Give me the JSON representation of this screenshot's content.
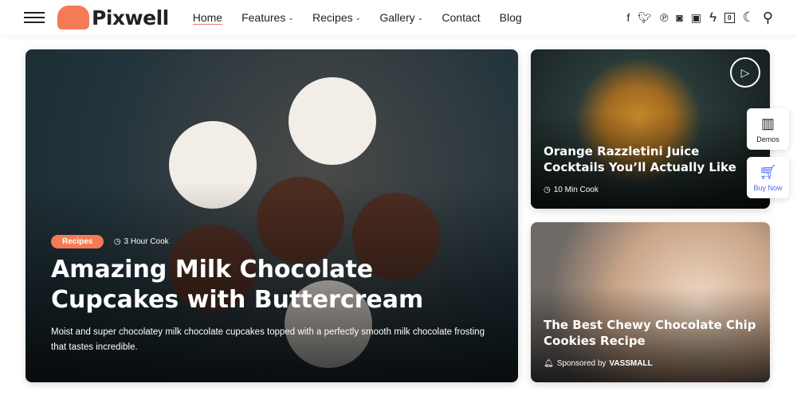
{
  "header": {
    "logo": "Pixwell",
    "nav": [
      {
        "label": "Home",
        "active": true
      },
      {
        "label": "Features",
        "dropdown": true
      },
      {
        "label": "Recipes",
        "dropdown": true
      },
      {
        "label": "Gallery",
        "dropdown": true
      },
      {
        "label": "Contact"
      },
      {
        "label": "Blog"
      }
    ],
    "icons": [
      "facebook-icon",
      "twitter-icon",
      "pinterest-icon",
      "instagram-icon",
      "youtube-icon",
      "lightning-icon",
      "bookmark-icon",
      "dark-mode-icon",
      "search-icon"
    ],
    "bookmark_count": "0"
  },
  "featured": {
    "category": "Recipes",
    "meta": "3 Hour Cook",
    "title": "Amazing Milk Chocolate Cupcakes with Buttercream",
    "excerpt": "Moist and super chocolatey milk chocolate cupcakes topped with a perfectly smooth milk chocolate frosting that tastes incredible."
  },
  "side": [
    {
      "title": "Orange Razzletini Juice Cocktails You’ll Actually Like",
      "meta": "10 Min Cook",
      "has_video": true
    },
    {
      "title": "The Best Chewy Chocolate Chip Cookies Recipe",
      "sponsor_prefix": "Sponsored by",
      "sponsor": "VASSMALL"
    }
  ],
  "floating": {
    "demos": "Demos",
    "buy": "Buy Now"
  },
  "colors": {
    "accent": "#f47b55",
    "buy": "#4a6cf7"
  }
}
